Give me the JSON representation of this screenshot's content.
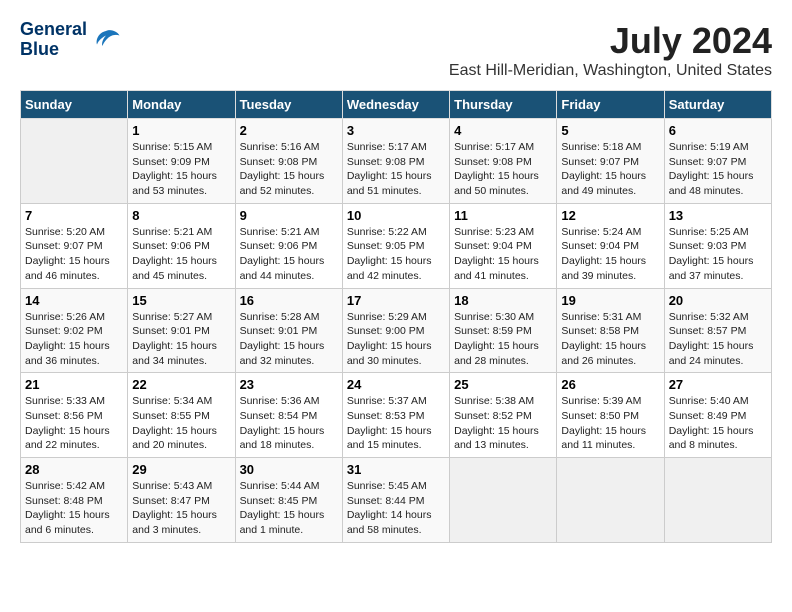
{
  "header": {
    "logo_line1": "General",
    "logo_line2": "Blue",
    "month": "July 2024",
    "location": "East Hill-Meridian, Washington, United States"
  },
  "days_of_week": [
    "Sunday",
    "Monday",
    "Tuesday",
    "Wednesday",
    "Thursday",
    "Friday",
    "Saturday"
  ],
  "weeks": [
    [
      {
        "day": "",
        "info": ""
      },
      {
        "day": "1",
        "info": "Sunrise: 5:15 AM\nSunset: 9:09 PM\nDaylight: 15 hours\nand 53 minutes."
      },
      {
        "day": "2",
        "info": "Sunrise: 5:16 AM\nSunset: 9:08 PM\nDaylight: 15 hours\nand 52 minutes."
      },
      {
        "day": "3",
        "info": "Sunrise: 5:17 AM\nSunset: 9:08 PM\nDaylight: 15 hours\nand 51 minutes."
      },
      {
        "day": "4",
        "info": "Sunrise: 5:17 AM\nSunset: 9:08 PM\nDaylight: 15 hours\nand 50 minutes."
      },
      {
        "day": "5",
        "info": "Sunrise: 5:18 AM\nSunset: 9:07 PM\nDaylight: 15 hours\nand 49 minutes."
      },
      {
        "day": "6",
        "info": "Sunrise: 5:19 AM\nSunset: 9:07 PM\nDaylight: 15 hours\nand 48 minutes."
      }
    ],
    [
      {
        "day": "7",
        "info": "Sunrise: 5:20 AM\nSunset: 9:07 PM\nDaylight: 15 hours\nand 46 minutes."
      },
      {
        "day": "8",
        "info": "Sunrise: 5:21 AM\nSunset: 9:06 PM\nDaylight: 15 hours\nand 45 minutes."
      },
      {
        "day": "9",
        "info": "Sunrise: 5:21 AM\nSunset: 9:06 PM\nDaylight: 15 hours\nand 44 minutes."
      },
      {
        "day": "10",
        "info": "Sunrise: 5:22 AM\nSunset: 9:05 PM\nDaylight: 15 hours\nand 42 minutes."
      },
      {
        "day": "11",
        "info": "Sunrise: 5:23 AM\nSunset: 9:04 PM\nDaylight: 15 hours\nand 41 minutes."
      },
      {
        "day": "12",
        "info": "Sunrise: 5:24 AM\nSunset: 9:04 PM\nDaylight: 15 hours\nand 39 minutes."
      },
      {
        "day": "13",
        "info": "Sunrise: 5:25 AM\nSunset: 9:03 PM\nDaylight: 15 hours\nand 37 minutes."
      }
    ],
    [
      {
        "day": "14",
        "info": "Sunrise: 5:26 AM\nSunset: 9:02 PM\nDaylight: 15 hours\nand 36 minutes."
      },
      {
        "day": "15",
        "info": "Sunrise: 5:27 AM\nSunset: 9:01 PM\nDaylight: 15 hours\nand 34 minutes."
      },
      {
        "day": "16",
        "info": "Sunrise: 5:28 AM\nSunset: 9:01 PM\nDaylight: 15 hours\nand 32 minutes."
      },
      {
        "day": "17",
        "info": "Sunrise: 5:29 AM\nSunset: 9:00 PM\nDaylight: 15 hours\nand 30 minutes."
      },
      {
        "day": "18",
        "info": "Sunrise: 5:30 AM\nSunset: 8:59 PM\nDaylight: 15 hours\nand 28 minutes."
      },
      {
        "day": "19",
        "info": "Sunrise: 5:31 AM\nSunset: 8:58 PM\nDaylight: 15 hours\nand 26 minutes."
      },
      {
        "day": "20",
        "info": "Sunrise: 5:32 AM\nSunset: 8:57 PM\nDaylight: 15 hours\nand 24 minutes."
      }
    ],
    [
      {
        "day": "21",
        "info": "Sunrise: 5:33 AM\nSunset: 8:56 PM\nDaylight: 15 hours\nand 22 minutes."
      },
      {
        "day": "22",
        "info": "Sunrise: 5:34 AM\nSunset: 8:55 PM\nDaylight: 15 hours\nand 20 minutes."
      },
      {
        "day": "23",
        "info": "Sunrise: 5:36 AM\nSunset: 8:54 PM\nDaylight: 15 hours\nand 18 minutes."
      },
      {
        "day": "24",
        "info": "Sunrise: 5:37 AM\nSunset: 8:53 PM\nDaylight: 15 hours\nand 15 minutes."
      },
      {
        "day": "25",
        "info": "Sunrise: 5:38 AM\nSunset: 8:52 PM\nDaylight: 15 hours\nand 13 minutes."
      },
      {
        "day": "26",
        "info": "Sunrise: 5:39 AM\nSunset: 8:50 PM\nDaylight: 15 hours\nand 11 minutes."
      },
      {
        "day": "27",
        "info": "Sunrise: 5:40 AM\nSunset: 8:49 PM\nDaylight: 15 hours\nand 8 minutes."
      }
    ],
    [
      {
        "day": "28",
        "info": "Sunrise: 5:42 AM\nSunset: 8:48 PM\nDaylight: 15 hours\nand 6 minutes."
      },
      {
        "day": "29",
        "info": "Sunrise: 5:43 AM\nSunset: 8:47 PM\nDaylight: 15 hours\nand 3 minutes."
      },
      {
        "day": "30",
        "info": "Sunrise: 5:44 AM\nSunset: 8:45 PM\nDaylight: 15 hours\nand 1 minute."
      },
      {
        "day": "31",
        "info": "Sunrise: 5:45 AM\nSunset: 8:44 PM\nDaylight: 14 hours\nand 58 minutes."
      },
      {
        "day": "",
        "info": ""
      },
      {
        "day": "",
        "info": ""
      },
      {
        "day": "",
        "info": ""
      }
    ]
  ]
}
